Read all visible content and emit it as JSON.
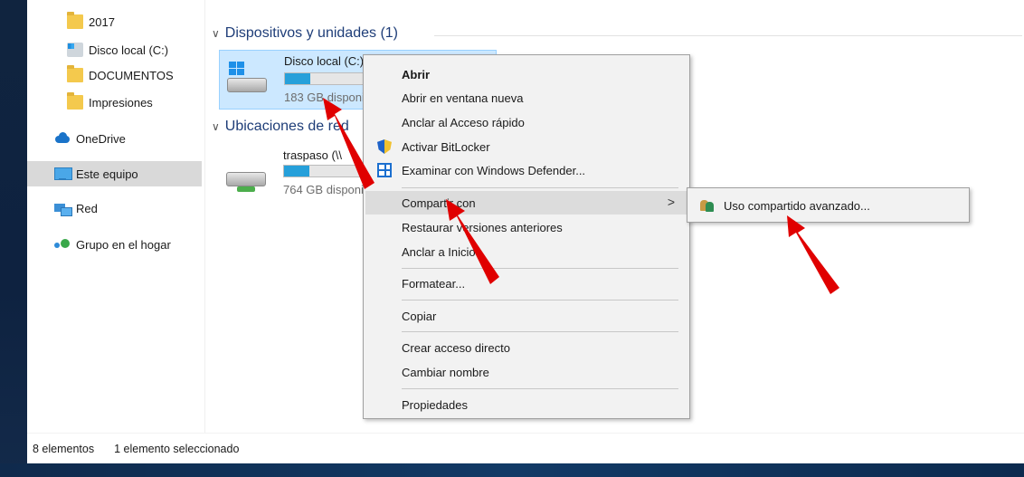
{
  "nav": {
    "items": [
      {
        "label": "2017",
        "icon": "folder-icon"
      },
      {
        "label": "Disco local (C:)",
        "icon": "drive-icon"
      },
      {
        "label": "DOCUMENTOS",
        "icon": "folder-icon"
      },
      {
        "label": "Impresiones",
        "icon": "folder-icon"
      },
      {
        "label": "OneDrive",
        "icon": "cloud-icon"
      },
      {
        "label": "Este equipo",
        "icon": "computer-icon"
      },
      {
        "label": "Red",
        "icon": "network-icon"
      },
      {
        "label": "Grupo en el hogar",
        "icon": "homegroup-icon"
      }
    ]
  },
  "content": {
    "devices_header": "Dispositivos y unidades (1)",
    "locations_header": "Ubicaciones de red",
    "drive_c": {
      "name": "Disco local (C:)",
      "free": "183 GB disponibles",
      "usage_fraction": 0.33
    },
    "traspaso": {
      "name": "traspaso (\\\\",
      "free": "764 GB disponibles",
      "usage_fraction": 0.32
    }
  },
  "context_menu": {
    "items": [
      {
        "label": "Abrir"
      },
      {
        "label": "Abrir en ventana nueva"
      },
      {
        "label": "Anclar al Acceso rápido"
      },
      {
        "label": "Activar BitLocker"
      },
      {
        "label": "Examinar con Windows Defender..."
      },
      {
        "label": "Compartir con"
      },
      {
        "label": "Restaurar versiones anteriores"
      },
      {
        "label": "Anclar a Inicio"
      },
      {
        "label": "Formatear..."
      },
      {
        "label": "Copiar"
      },
      {
        "label": "Crear acceso directo"
      },
      {
        "label": "Cambiar nombre"
      },
      {
        "label": "Propiedades"
      }
    ]
  },
  "submenu": {
    "items": [
      {
        "label": "Uso compartido avanzado..."
      }
    ]
  },
  "status": {
    "count": "8 elementos",
    "selection": "1 elemento seleccionado"
  },
  "colors": {
    "accent": "#26a0da",
    "selection": "#cce8ff",
    "arrow": "#e00000"
  }
}
